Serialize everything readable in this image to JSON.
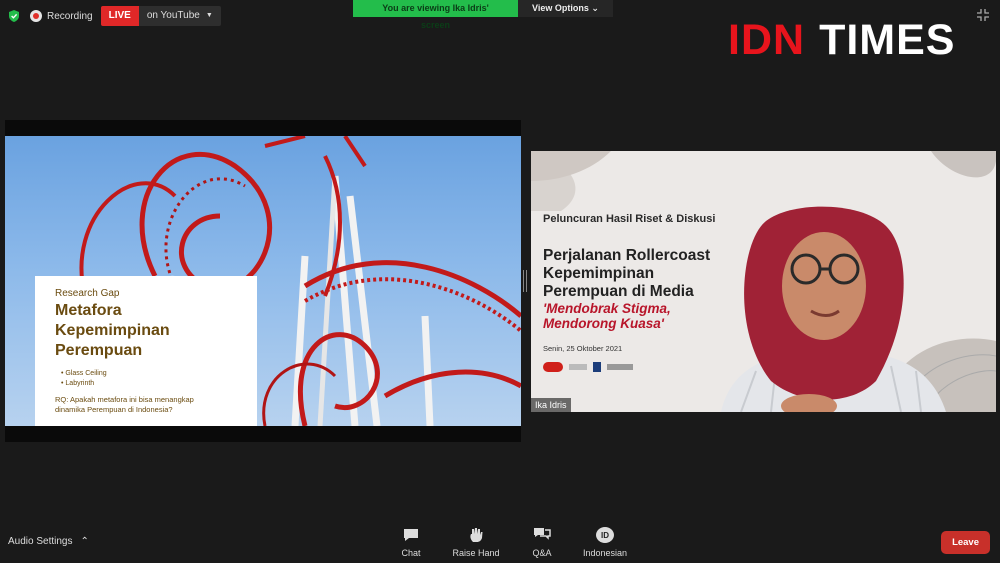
{
  "status": {
    "recording_label": "Recording",
    "live_label": "LIVE",
    "stream_target": "on YouTube"
  },
  "banner": {
    "viewing_text": "You are viewing Ika Idris' screen",
    "view_options_label": "View Options"
  },
  "logo": {
    "part1": "IDN",
    "part2": "TIMES"
  },
  "slide": {
    "subtitle": "Research Gap",
    "title_line1": "Metafora",
    "title_line2": "Kepemimpinan",
    "title_line3": "Perempuan",
    "bullets": [
      "Glass Ceiling",
      "Labyrinth"
    ],
    "rq_line1": "RQ: Apakah metafora ini bisa menangkap",
    "rq_line2": "dinamika Perempuan di Indonesia?"
  },
  "participant": {
    "name": "Ika Idris",
    "bg_small": "Peluncuran Hasil Riset & Diskusi",
    "bg_line1": "Perjalanan Rollercoast",
    "bg_line2": "Kepemimpinan",
    "bg_line3": "Perempuan di Media",
    "bg_red1": "'Mendobrak Stigma,",
    "bg_red2": "Mendorong Kuasa'",
    "bg_date": "Senin, 25 Oktober 2021"
  },
  "controls": {
    "audio_settings": "Audio Settings",
    "chat": "Chat",
    "raise_hand": "Raise Hand",
    "qa": "Q&A",
    "language": "Indonesian",
    "language_badge": "ID",
    "leave": "Leave"
  },
  "colors": {
    "live_red": "#e02828",
    "banner_green": "#23bd4b",
    "logo_red": "#e8141c",
    "leave_red": "#c8302a"
  }
}
